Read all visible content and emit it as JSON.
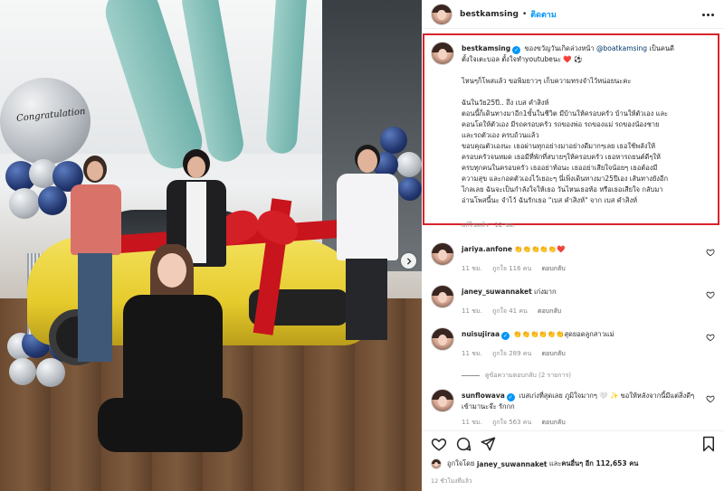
{
  "post": {
    "username": "bestkamsing",
    "follow_label": "ติดตาม",
    "separator": "•"
  },
  "photo": {
    "balloon_text": "Congratulation"
  },
  "caption": {
    "username": "bestkamsing",
    "lines": [
      "ของขวัญวันเกิดล่วงหน้า",
      "@boatkamsing",
      "เป็นคนดี",
      "ตั้งใจเตะบอล ตั้งใจทำyoutubeนะ ❤️ ⚽",
      "ไหนๆก็โพสแล้ว ขอพิมยาวๆ เก็บความทรงจำไว้หน่อยนะคะ",
      "ฉันในวัย25ปี.. ถึง เบส คำสิงห์",
      "ตอนนี้ก็เดินทางมาอีก1ขั้นในชีวิต มีบ้านให้ครอบครัว บ้านให้ตัวเอง และ",
      "คอนโดให้ตัวเอง มีรถครอบครัว รถของพ่อ รถของแม่ รถของน้องชาย",
      "และรถตัวเอง ครบถ้วนแล้ว",
      "ขอบคุณตัวเองนะ เธอผ่านทุกอย่างมาอย่างดีมากๆเลย เธอใช้พลังให้",
      "ครอบครัวจนหมด เธอมีที่พักที่สบายๆให้ครอบครัว เธอหารถยนต์ดีๆให้",
      "ครบทุกคนในครอบครัว เธออย่าท้อนะ เธออย่าเสียใจน้อยๆ เธอต้องมี",
      "ความสุข และกอดตัวเองไว้เยอะๆ นี่เพิ่งเดินทางมา25ปีเอง เส้นทางยังอีก",
      "ไกลเลย ฉันจะเป็นกำลังใจให้เธอ วันไหนเธอท้อ หรือเธอเสียใจ กลับมา",
      "อ่านโพสนี้นะ จำไว้ ฉันรักเธอ \"เบส คำสิงห์\" จาก เบส คำสิงห์"
    ],
    "time": "แก้ไขแล้ว · 12 ชม."
  },
  "comments": [
    {
      "user": "jariya.anfone",
      "verified": false,
      "text": "👏👏👏👏👏❤️",
      "time": "11 ชม.",
      "likes": "ถูกใจ 116 คน",
      "reply": "ตอบกลับ"
    },
    {
      "user": "janey_suwannaket",
      "verified": false,
      "text": "เก่งมาก",
      "time": "11 ชม.",
      "likes": "ถูกใจ 41 คน",
      "reply": "ตอบกลับ"
    },
    {
      "user": "nuisujiraa",
      "verified": true,
      "text": "👏👏👏👏👏👏สุดยอดลูกสาวแม่",
      "time": "11 ชม.",
      "likes": "ถูกใจ 289 คน",
      "reply": "ตอบกลับ"
    },
    {
      "user": "sunflowava",
      "verified": true,
      "text": "เบสเก่งที่สุดเลย ภูมิใจมากๆ 🤍 ✨ ขอให้หลังจากนี้มีแต่สิ่งดีๆเข้ามานะจ๊ะ รักกก",
      "time": "11 ชม.",
      "likes": "ถูกใจ 563 คน",
      "reply": "ตอบกลับ"
    }
  ],
  "view_replies": "ดูข้อความตอบกลับ (2 รายการ)",
  "likes_line": {
    "prefix": "ถูกใจโดย",
    "user": "janey_suwannaket",
    "middle": "และ",
    "others": "คนอื่นๆ อีก 112,653 คน"
  },
  "posted_time": "12 ชั่วโมงที่แล้ว",
  "icons": {
    "heart": "heart-icon",
    "comment": "comment-icon",
    "share": "share-icon",
    "save": "bookmark-icon",
    "next": "chevron-right-icon",
    "more": "more-icon"
  },
  "colors": {
    "highlight_border": "#d8242c",
    "follow_blue": "#0095f6",
    "verified_blue": "#0095f6",
    "mention": "#00376b"
  }
}
